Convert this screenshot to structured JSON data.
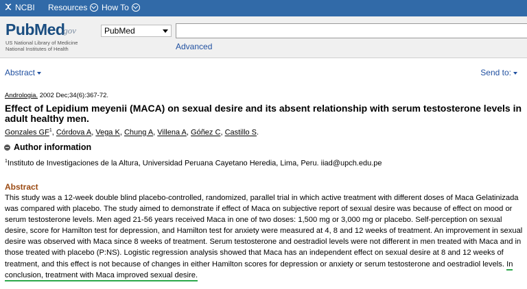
{
  "ncbi": {
    "logo": "NCBI",
    "resources": "Resources",
    "howto": "How To"
  },
  "logo": {
    "word": "PubMed",
    "gov": ".gov",
    "line1": "US National Library of Medicine",
    "line2": "National Institutes of Health"
  },
  "search": {
    "database": "PubMed",
    "query": "",
    "advanced": "Advanced"
  },
  "toolbar": {
    "format": "Abstract",
    "send_to": "Send to:"
  },
  "article": {
    "journal": "Andrologia.",
    "citation_rest": " 2002 Dec;34(6):367-72.",
    "title": "Effect of Lepidium meyenii (MACA) on sexual desire and its absent relationship with serum testosterone levels in adult healthy men.",
    "authors": [
      "Gonzales GF",
      "Córdova A",
      "Vega K",
      "Chung A",
      "Villena A",
      "Góñez C",
      "Castillo S"
    ],
    "first_author_sup": "1",
    "author_info_heading": "Author information",
    "affiliation_sup": "1",
    "affiliation": "Instituto de Investigaciones de la Altura, Universidad Peruana Cayetano Heredia, Lima, Peru. iiad@upch.edu.pe",
    "abstract_heading": "Abstract",
    "abstract_text": "This study was a 12-week double blind placebo-controlled, randomized, parallel trial in which active treatment with different doses of Maca Gelatinizada was compared with placebo. The study aimed to demonstrate if effect of Maca on subjective report of sexual desire was because of effect on mood or serum testosterone levels. Men aged 21-56 years received Maca in one of two doses: 1,500 mg or 3,000 mg or placebo. Self-perception on sexual desire, score for Hamilton test for depression, and Hamilton test for anxiety were measured at 4, 8 and 12 weeks of treatment. An improvement in sexual desire was observed with Maca since 8 weeks of treatment. Serum testosterone and oestradiol levels were not different in men treated with Maca and in those treated with placebo (P:NS). Logistic regression analysis showed that Maca has an independent effect on sexual desire at 8 and 12 weeks of treatment, and this effect is not because of changes in either Hamilton scores for depression or anxiety or serum testosterone and oestradiol levels. ",
    "abstract_conclusion": "In conclusion, treatment with Maca improved sexual desire."
  },
  "colors": {
    "ncbi_bar": "#316aa8",
    "link": "#2050a0",
    "abstract_heading": "#9b4a12",
    "highlight": "#2aa84a"
  }
}
